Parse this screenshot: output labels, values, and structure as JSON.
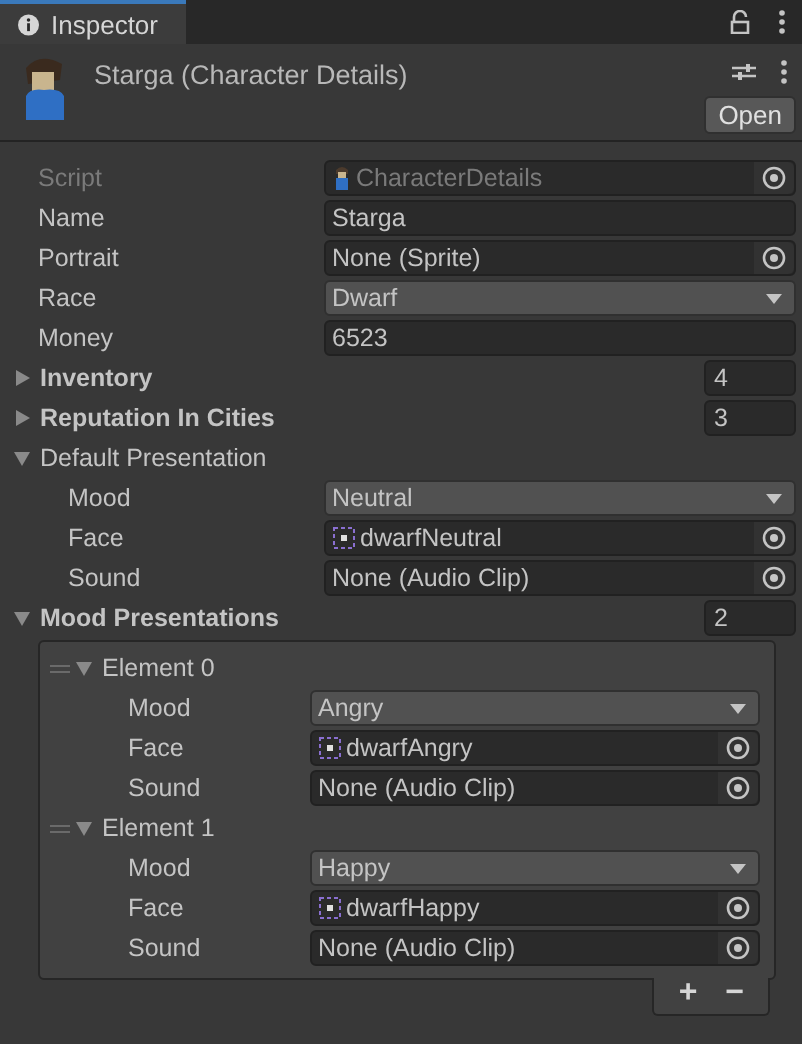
{
  "tab": {
    "label": "Inspector"
  },
  "header": {
    "title": "Starga (Character Details)",
    "button": "Open"
  },
  "fields": [
    {
      "kind": "object",
      "label": "Script",
      "value": "CharacterDetails",
      "asset": {
        "kind": "script"
      },
      "disabled": true
    },
    {
      "kind": "text",
      "label": "Name",
      "value": "Starga",
      "disabled": false
    },
    {
      "kind": "object",
      "label": "Portrait",
      "value": "None (Sprite)",
      "disabled": false
    },
    {
      "kind": "dropdown",
      "label": "Race",
      "value": "Dwarf",
      "disabled": false
    },
    {
      "kind": "text",
      "label": "Money",
      "value": "6523",
      "disabled": false
    },
    {
      "kind": "array",
      "label": "Inventory",
      "count": "4",
      "expanded": false,
      "disabled": false
    },
    {
      "kind": "array",
      "label": "Reputation In Cities",
      "count": "3",
      "expanded": false,
      "disabled": false
    },
    {
      "kind": "struct",
      "label": "Default Presentation",
      "expanded": true,
      "disabled": false,
      "children": [
        {
          "kind": "dropdown",
          "label": "Mood",
          "value": "Neutral"
        },
        {
          "kind": "object",
          "label": "Face",
          "value": "dwarfNeutral",
          "asset": {
            "kind": "sprite"
          }
        },
        {
          "kind": "object",
          "label": "Sound",
          "value": "None (Audio Clip)"
        }
      ]
    },
    {
      "kind": "array",
      "label": "Mood Presentations",
      "count": "2",
      "expanded": true,
      "disabled": false,
      "buttons": [
        "+",
        "−"
      ],
      "children": [
        {
          "kind": "element",
          "label": "Element 0",
          "expanded": true,
          "children": [
            {
              "kind": "dropdown",
              "label": "Mood",
              "value": "Angry"
            },
            {
              "kind": "object",
              "label": "Face",
              "value": "dwarfAngry",
              "asset": {
                "kind": "sprite"
              }
            },
            {
              "kind": "object",
              "label": "Sound",
              "value": "None (Audio Clip)"
            }
          ]
        },
        {
          "kind": "element",
          "label": "Element 1",
          "expanded": true,
          "children": [
            {
              "kind": "dropdown",
              "label": "Mood",
              "value": "Happy"
            },
            {
              "kind": "object",
              "label": "Face",
              "value": "dwarfHappy",
              "asset": {
                "kind": "sprite"
              }
            },
            {
              "kind": "object",
              "label": "Sound",
              "value": "None (Audio Clip)"
            }
          ]
        }
      ]
    }
  ]
}
